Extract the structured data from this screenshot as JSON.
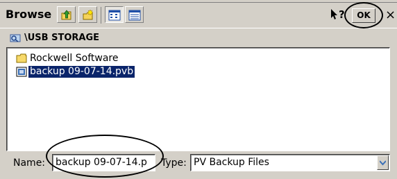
{
  "window": {
    "title": "Browse",
    "toolbar": {
      "buttons": [
        {
          "name": "up-folder",
          "icon": "up-folder-icon"
        },
        {
          "name": "new-folder",
          "icon": "new-folder-icon"
        },
        {
          "name": "list-view",
          "icon": "list-view-icon",
          "pressed": true
        },
        {
          "name": "details-view",
          "icon": "details-view-icon"
        }
      ],
      "help_icon": "help-pointer-icon",
      "ok_label": "OK",
      "close_label": "×"
    }
  },
  "path": {
    "icon": "drive-icon",
    "text": "\\USB STORAGE"
  },
  "files": [
    {
      "name": "Rockwell Software",
      "icon": "folder-icon",
      "selected": false
    },
    {
      "name": "backup 09-07-14.pvb",
      "icon": "pvb-file-icon",
      "selected": true
    }
  ],
  "form": {
    "name_label": "Name:",
    "name_value": "backup 09-07-14.p",
    "type_label": "Type:",
    "type_value": "PV Backup Files"
  }
}
